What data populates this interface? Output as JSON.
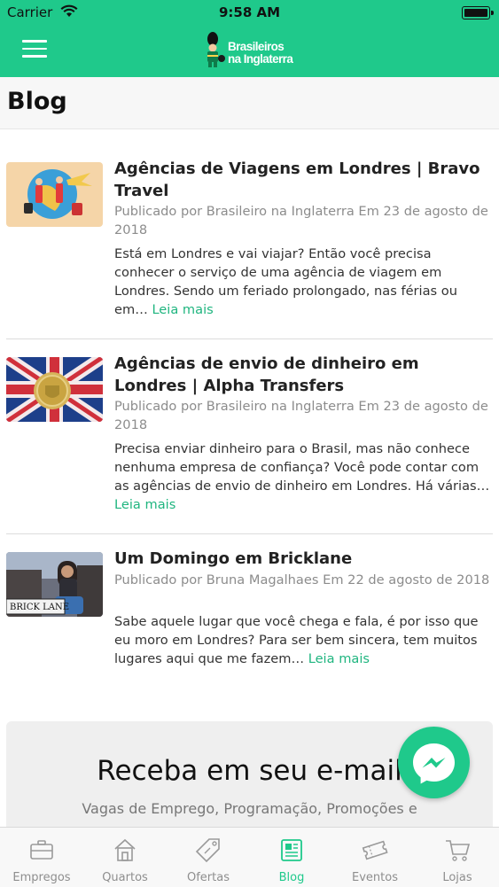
{
  "status_bar": {
    "carrier": "Carrier",
    "time": "9:58 AM"
  },
  "header": {
    "logo_line1": "Brasileiros",
    "logo_line2": "na Inglaterra"
  },
  "page": {
    "title": "Blog"
  },
  "posts": [
    {
      "title": "Agências de Viagens em Londres | Bravo Travel",
      "meta": "Publicado por Brasileiro na Inglaterra Em 23 de agosto de 2018",
      "excerpt": "Está em Londres e vai viajar? Então você precisa conhecer o serviço de uma agência de viagem em Londres. Sendo um feriado prolongado, nas férias ou em…",
      "read_more": "Leia mais"
    },
    {
      "title": "Agências de envio de dinheiro em Londres | Alpha Transfers",
      "meta": "Publicado por Brasileiro na Inglaterra Em 23 de agosto de 2018",
      "excerpt": "Precisa enviar dinheiro para o Brasil, mas não conhece nenhuma empresa de confiança? Você pode contar com as agências de envio de dinheiro em Londres. Há várias…",
      "read_more": "Leia mais"
    },
    {
      "title": "Um Domingo em Bricklane",
      "meta": "Publicado por Bruna Magalhaes Em 22 de agosto de 2018",
      "excerpt": "Sabe aquele lugar que você chega e fala, é por isso que eu moro em Londres? Para ser bem sincera, tem muitos lugares aqui que me fazem…",
      "read_more": "Leia mais",
      "image_sign_text": "BRICK LANE"
    }
  ],
  "newsletter": {
    "title": "Receba em seu e-mail",
    "subtitle": "Vagas de Emprego, Programação, Promoções e"
  },
  "tabs": [
    {
      "label": "Empregos",
      "icon": "briefcase-icon"
    },
    {
      "label": "Quartos",
      "icon": "house-icon"
    },
    {
      "label": "Ofertas",
      "icon": "tag-icon"
    },
    {
      "label": "Blog",
      "icon": "blog-icon",
      "active": true
    },
    {
      "label": "Eventos",
      "icon": "ticket-icon"
    },
    {
      "label": "Lojas",
      "icon": "cart-icon"
    }
  ],
  "colors": {
    "brand_green": "#1fc98b",
    "link_green": "#1fb57f",
    "inactive_tab": "#8e8e8e"
  }
}
